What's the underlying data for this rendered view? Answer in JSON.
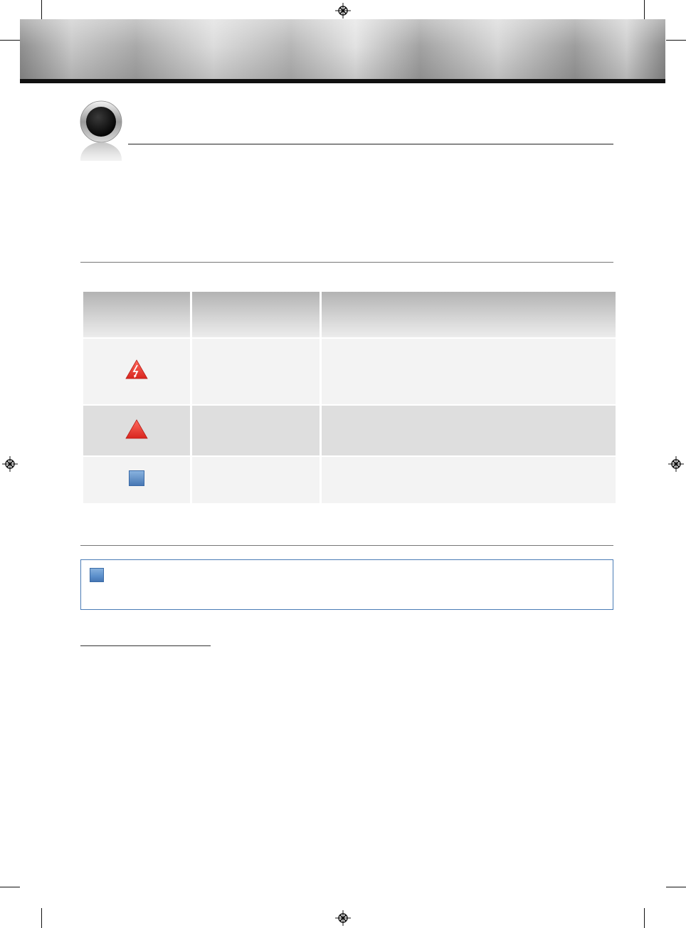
{
  "colors": {
    "note_border": "#4a7bb5",
    "warning_red": "#e8322b",
    "info_blue": "#5b8fcb",
    "header_gray": "#c8c8c8",
    "row_light": "#f3f3f3",
    "row_dark": "#dedede"
  },
  "table": {
    "header": [
      "",
      "",
      ""
    ],
    "rows": [
      {
        "icon": "electric-shock-warning-icon",
        "term": "",
        "description": ""
      },
      {
        "icon": "warning-triangle-icon",
        "term": "",
        "description": ""
      },
      {
        "icon": "note-square-icon",
        "term": "",
        "description": ""
      }
    ]
  },
  "note": {
    "icon": "note-square-icon",
    "text": ""
  }
}
